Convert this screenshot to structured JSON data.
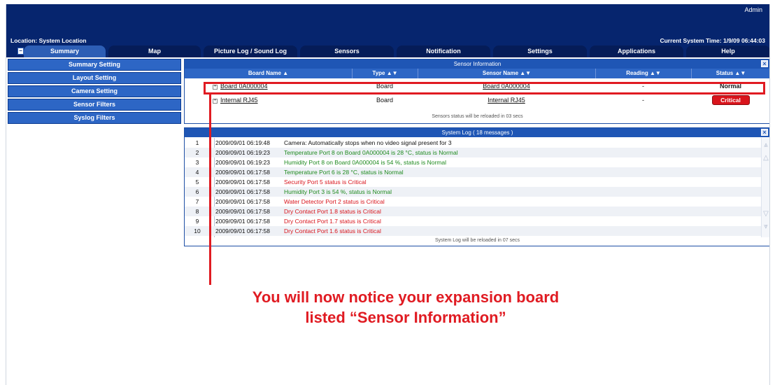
{
  "header": {
    "admin": "Admin",
    "location": "Location: System Location",
    "system_time": "Current System Time: 1/9/09 06:44:03"
  },
  "tabs": [
    {
      "label": "Summary"
    },
    {
      "label": "Map"
    },
    {
      "label": "Picture Log / Sound Log"
    },
    {
      "label": "Sensors"
    },
    {
      "label": "Notification"
    },
    {
      "label": "Settings"
    },
    {
      "label": "Applications"
    },
    {
      "label": "Help"
    }
  ],
  "sidebar": {
    "items": [
      {
        "label": "Summary Setting"
      },
      {
        "label": "Layout Setting"
      },
      {
        "label": "Camera Setting"
      },
      {
        "label": "Sensor Filters"
      },
      {
        "label": "Syslog Filters"
      }
    ]
  },
  "sensor_info": {
    "title": "Sensor Information",
    "columns": [
      "Board Name ▲",
      "Type ▲▼",
      "Sensor Name ▲▼",
      "Reading ▲▼",
      "Status ▲▼"
    ],
    "rows": [
      {
        "board": "Board 0A000004",
        "type": "Board",
        "sensor": "Board 0A000004",
        "reading": "-",
        "status": "Normal"
      },
      {
        "board": "Internal RJ45",
        "type": "Board",
        "sensor": "Internal RJ45",
        "reading": "-",
        "status": "Critical"
      }
    ],
    "note": "Sensors status will be reloaded in 03 secs"
  },
  "system_log": {
    "title": "System Log ( 18 messages )",
    "entries": [
      {
        "num": "1",
        "time": "2009/09/01 06:19:48",
        "msg": "Camera: Automatically stops when no video signal present for 3"
      },
      {
        "num": "2",
        "time": "2009/09/01 06:19:23",
        "msg": "Temperature Port 8 on Board 0A000004 is 28 °C, status is Normal"
      },
      {
        "num": "3",
        "time": "2009/09/01 06:19:23",
        "msg": "Humidity Port 8 on Board 0A000004 is 54 %, status is Normal"
      },
      {
        "num": "4",
        "time": "2009/09/01 06:17:58",
        "msg": "Temperature Port 6 is 28 °C, status is Normal"
      },
      {
        "num": "5",
        "time": "2009/09/01 06:17:58",
        "msg": "Security Port 5 status is Critical"
      },
      {
        "num": "6",
        "time": "2009/09/01 06:17:58",
        "msg": "Humidity Port 3 is 54 %, status is Normal"
      },
      {
        "num": "7",
        "time": "2009/09/01 06:17:58",
        "msg": "Water Detector Port 2 status is Critical"
      },
      {
        "num": "8",
        "time": "2009/09/01 06:17:58",
        "msg": "Dry Contact Port 1.8 status is Critical"
      },
      {
        "num": "9",
        "time": "2009/09/01 06:17:58",
        "msg": "Dry Contact Port 1.7 status is Critical"
      },
      {
        "num": "10",
        "time": "2009/09/01 06:17:58",
        "msg": "Dry Contact Port 1.6 status is Critical"
      }
    ],
    "note": "System Log will be reloaded in 07 secs"
  },
  "annotation": {
    "line1": "You will now notice your expansion board",
    "line2": "listed “Sensor Information”"
  },
  "colors": {
    "header_bg": "#06256e",
    "tab_active": "#2d5eb5",
    "panel_title": "#1f56b5",
    "normal_text": "#1f8a1f",
    "critical_text": "#d9141c",
    "annotation": "#e01b22"
  },
  "icons": {
    "collapse": "minus-square-icon",
    "close": "close-box-icon",
    "expand": "plus-square-icon",
    "scroll": "chevron-arrow-icon"
  }
}
